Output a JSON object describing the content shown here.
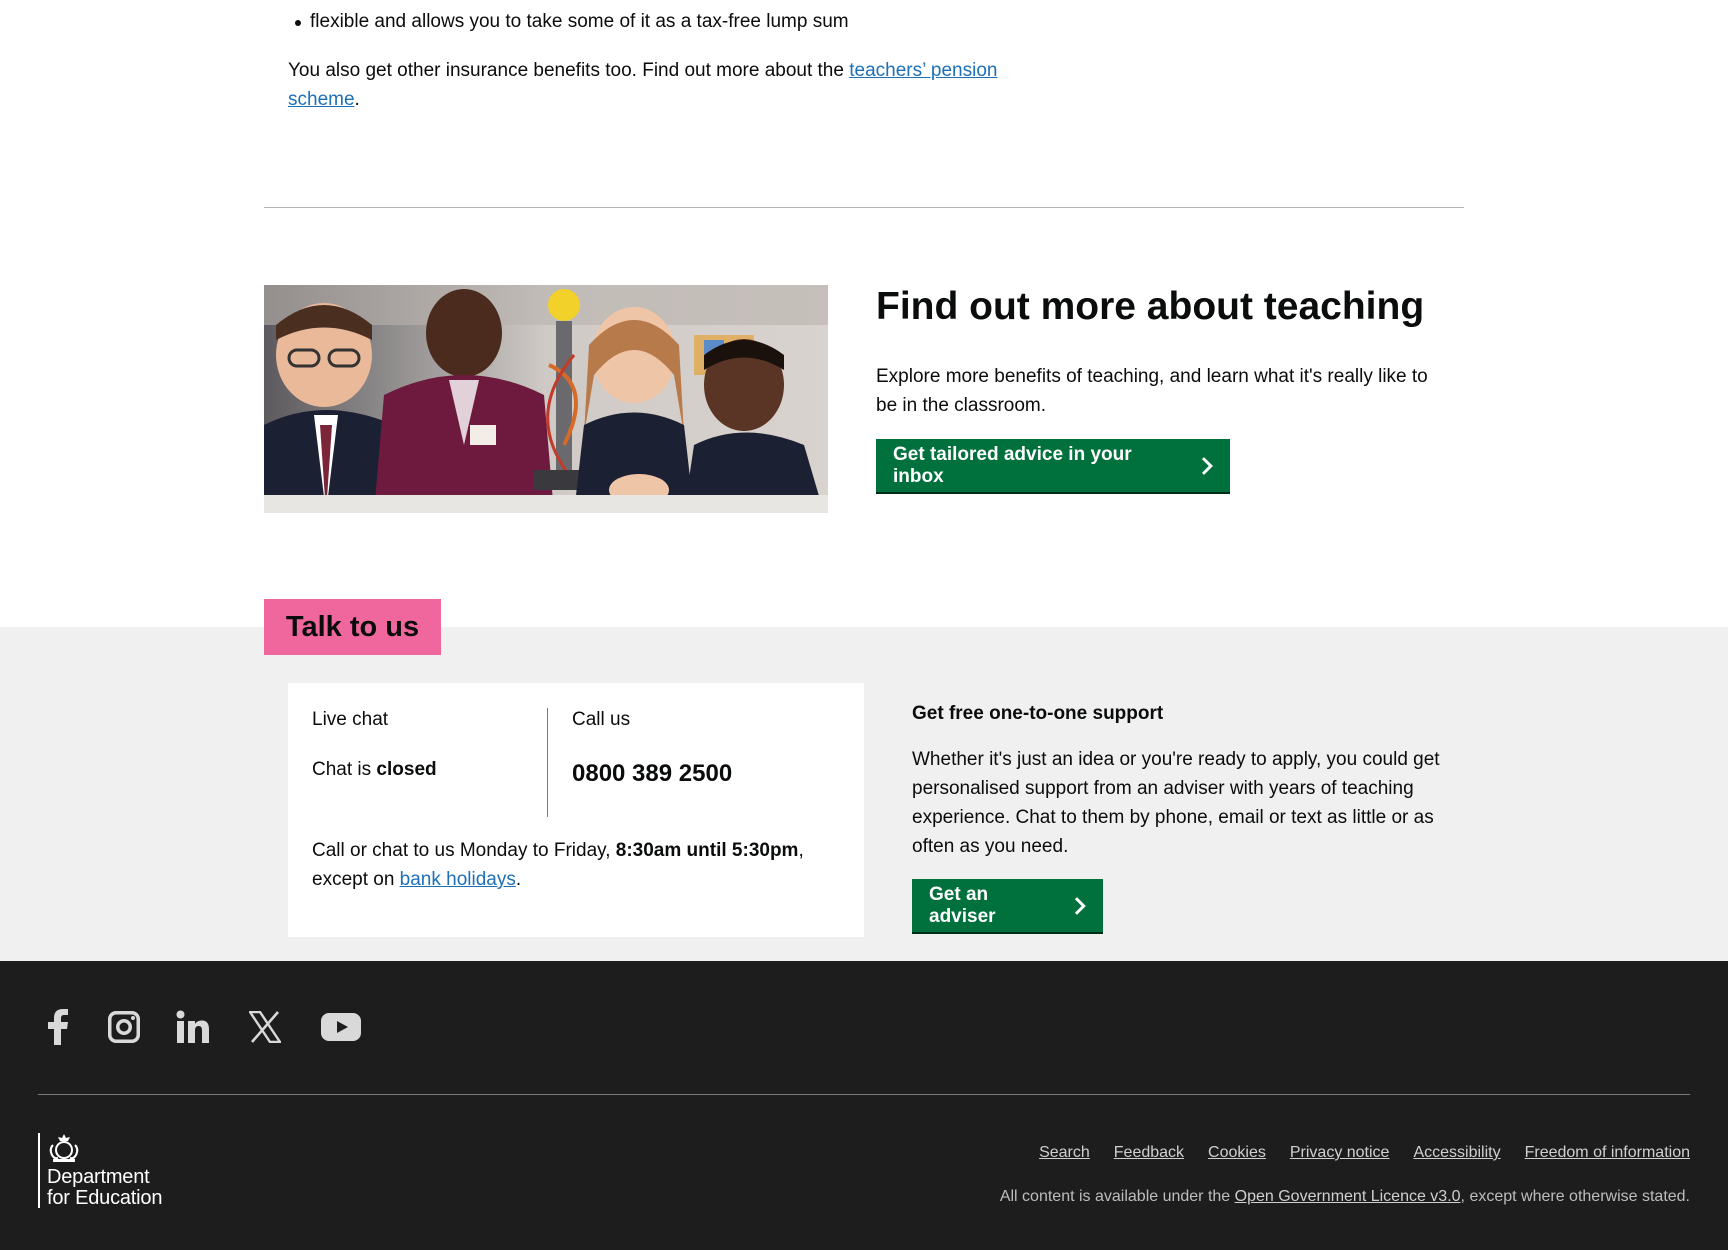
{
  "top": {
    "bullet": "flexible and allows you to take some of it as a tax-free lump sum",
    "para_prefix": "You also get other insurance benefits too. Find out more about the ",
    "para_link": "teachers’ pension scheme",
    "para_suffix": "."
  },
  "promo": {
    "title": "Find out more about teaching",
    "text": "Explore more benefits of teaching, and learn what it's really like to be in the classroom.",
    "button_label": "Get tailored advice in your inbox",
    "button_icon": "chevron-right-icon"
  },
  "talk": {
    "tag": "Talk to us",
    "live_chat_label": "Live chat",
    "chat_prefix": "Chat is ",
    "chat_status": "closed",
    "call_label": "Call us",
    "phone": "0800 389 2500",
    "hours_prefix": "Call or chat to us Monday to Friday, ",
    "hours_time": "8:30am until 5:30pm",
    "hours_middle": ", except on ",
    "hours_link": "bank holidays",
    "hours_suffix": ".",
    "support_heading": "Get free one-to-one support",
    "support_text": "Whether it's just an idea or you're ready to apply, you could get personalised support from an adviser with years of teaching experience. Chat to them by phone, email or text as little or as often as you need.",
    "adviser_button": "Get an adviser",
    "tag_color": "#f0679e",
    "divider_color": "#a05ab0"
  },
  "footer": {
    "social": [
      "facebook-icon",
      "instagram-icon",
      "linkedin-icon",
      "x-icon",
      "youtube-icon"
    ],
    "logo_line1": "Department",
    "logo_line2": "for Education",
    "links": [
      "Search",
      "Feedback",
      "Cookies",
      "Privacy notice",
      "Accessibility",
      "Freedom of information"
    ],
    "licence_prefix": "All content is available under the ",
    "licence_link": "Open Government Licence v3.0",
    "licence_suffix": ", except where otherwise stated."
  },
  "colors": {
    "button_green": "#00703c",
    "link_blue": "#1d70b8",
    "footer_bg": "#1d1d1d",
    "band_grey": "#f0f0f0"
  }
}
